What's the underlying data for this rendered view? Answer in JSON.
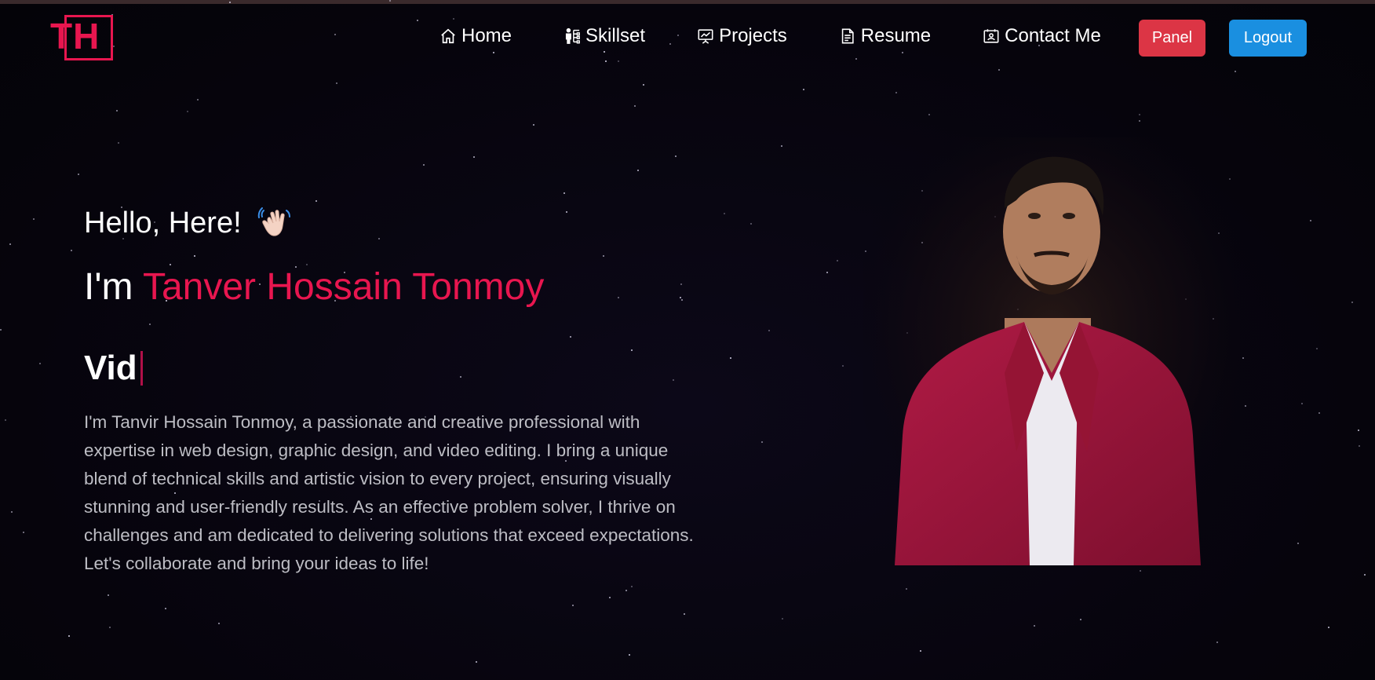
{
  "logo": {
    "text": "TH"
  },
  "nav": {
    "items": [
      {
        "label": "Home",
        "icon": "home-icon"
      },
      {
        "label": "Skillset",
        "icon": "skillset-icon"
      },
      {
        "label": "Projects",
        "icon": "projects-icon"
      },
      {
        "label": "Resume",
        "icon": "resume-icon"
      },
      {
        "label": "Contact Me",
        "icon": "contact-icon"
      }
    ],
    "panel_label": "Panel",
    "logout_label": "Logout"
  },
  "hero": {
    "greeting": "Hello, Here!",
    "intro_prefix": "I'm ",
    "name": "Tanver Hossain Tonmoy",
    "typed_text": "Vid",
    "bio": "I'm Tanvir Hossain Tonmoy, a passionate and creative professional with expertise in web design, graphic design, and video editing. I bring a unique blend of technical skills and artistic vision to every project, ensuring visually stunning and user-friendly results. As an effective problem solver, I thrive on challenges and am dedicated to delivering solutions that exceed expectations. Let's collaborate and bring your ideas to life!"
  },
  "colors": {
    "accent": "#e8164f",
    "panel_button": "#dc3545",
    "logout_button": "#1a8fe0",
    "background": "#07050e"
  }
}
